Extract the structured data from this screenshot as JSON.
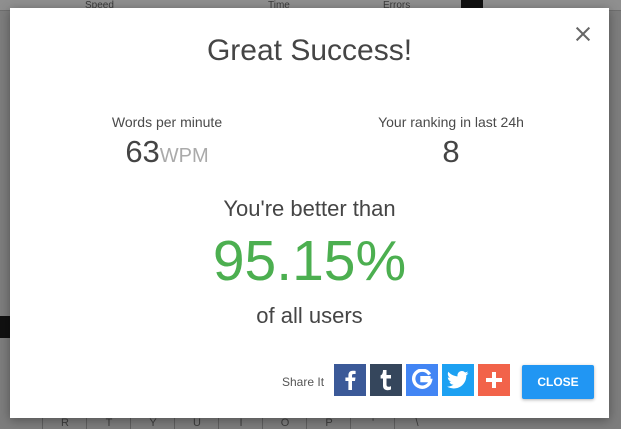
{
  "background": {
    "columns": [
      "Speed",
      "Time",
      "Errors"
    ],
    "keys": [
      "R",
      "T",
      "Y",
      "U",
      "I",
      "O",
      "P",
      "'",
      "\\"
    ]
  },
  "modal": {
    "title": "Great Success!",
    "close_icon": "close-icon",
    "stats": {
      "wpm_label": "Words per minute",
      "wpm_value": "63",
      "wpm_unit": "WPM",
      "ranking_label": "Your ranking in last 24h",
      "ranking_value": "8"
    },
    "better_than": "You're better than",
    "percent": "95.15%",
    "of_users": "of all users",
    "share": {
      "label": "Share It",
      "buttons": [
        {
          "icon": "facebook-icon",
          "color": "#3b5998"
        },
        {
          "icon": "tumblr-icon",
          "color": "#35465c"
        },
        {
          "icon": "google-icon",
          "color": "#4285f4"
        },
        {
          "icon": "twitter-icon",
          "color": "#1da1f2"
        },
        {
          "icon": "plus-icon",
          "color": "#f2634a"
        }
      ]
    },
    "close_label": "CLOSE"
  },
  "colors": {
    "accent_green": "#4caf50",
    "close_blue": "#2196f3"
  }
}
